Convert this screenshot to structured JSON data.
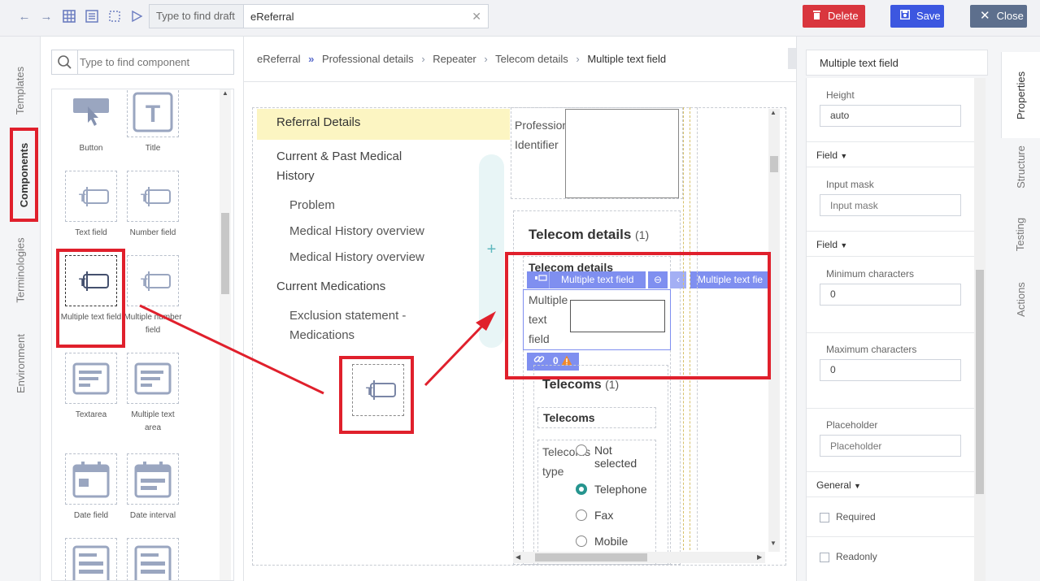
{
  "toolbar": {
    "search_label": "Type to find draft",
    "search_value": "eReferral",
    "delete_label": "Delete",
    "save_label": "Save",
    "close_label": "Close",
    "colors": {
      "delete": "#d9363e",
      "save": "#3c57e0",
      "close": "#5d6f8d"
    }
  },
  "left_tabs": {
    "templates": "Templates",
    "components": "Components",
    "terminologies": "Terminologies",
    "environment": "Environment"
  },
  "component_panel": {
    "search_placeholder": "Type to find component",
    "items": [
      {
        "label": "Button",
        "icon": "button-icon"
      },
      {
        "label": "Title",
        "icon": "title-icon"
      },
      {
        "label": "Text field",
        "icon": "text-field-icon"
      },
      {
        "label": "Number field",
        "icon": "number-field-icon"
      },
      {
        "label": "Multiple text field",
        "icon": "multiple-text-field-icon"
      },
      {
        "label": "Multiple number field",
        "icon": "multiple-number-field-icon"
      },
      {
        "label": "Textarea",
        "icon": "textarea-icon"
      },
      {
        "label": "Multiple text area",
        "icon": "multiple-text-area-icon"
      },
      {
        "label": "Date field",
        "icon": "date-field-icon"
      },
      {
        "label": "Date interval",
        "icon": "date-interval-icon"
      }
    ]
  },
  "breadcrumb": {
    "items": [
      "eReferral",
      "Professional details",
      "Repeater",
      "Telecom details",
      "Multiple text field"
    ]
  },
  "canvas": {
    "nav": {
      "referral_details": "Referral Details",
      "current_past": "Current & Past Medical History",
      "problem": "Problem",
      "overview1": "Medical History overview",
      "overview2": "Medical History overview",
      "current_medications": "Current Medications",
      "exclusion": "Exclusion statement - Medications"
    },
    "add_symbol": "+",
    "profession_text": "Profession Identifier",
    "telecom_details_title": "Telecom details",
    "telecom_details_count": "(1)",
    "telecom_details_sub": "Telecom details",
    "toolbar_label": "Multiple text field",
    "toolbar_label2": "Multiple text fie",
    "field_label": "Multiple text field",
    "link_count": "0",
    "telecoms_title": "Telecoms",
    "telecoms_count": "(1)",
    "telecoms_sub": "Telecoms",
    "telecoms_type": "Telecoms type",
    "radio_options": [
      "Not selected",
      "Telephone",
      "Fax",
      "Mobile"
    ],
    "radio_selected": "Telephone"
  },
  "properties": {
    "header": "Multiple text field",
    "height_label": "Height",
    "height_value": "auto",
    "field_section1": "Field",
    "input_mask_label": "Input mask",
    "input_mask_placeholder": "Input mask",
    "field_section2": "Field",
    "min_label": "Minimum characters",
    "min_value": "0",
    "max_label": "Maximum characters",
    "max_value": "0",
    "placeholder_label": "Placeholder",
    "placeholder_placeholder": "Placeholder",
    "general_section": "General",
    "required_label": "Required",
    "readonly_label": "Readonly"
  },
  "right_tabs": {
    "properties": "Properties",
    "structure": "Structure",
    "testing": "Testing",
    "actions": "Actions"
  }
}
